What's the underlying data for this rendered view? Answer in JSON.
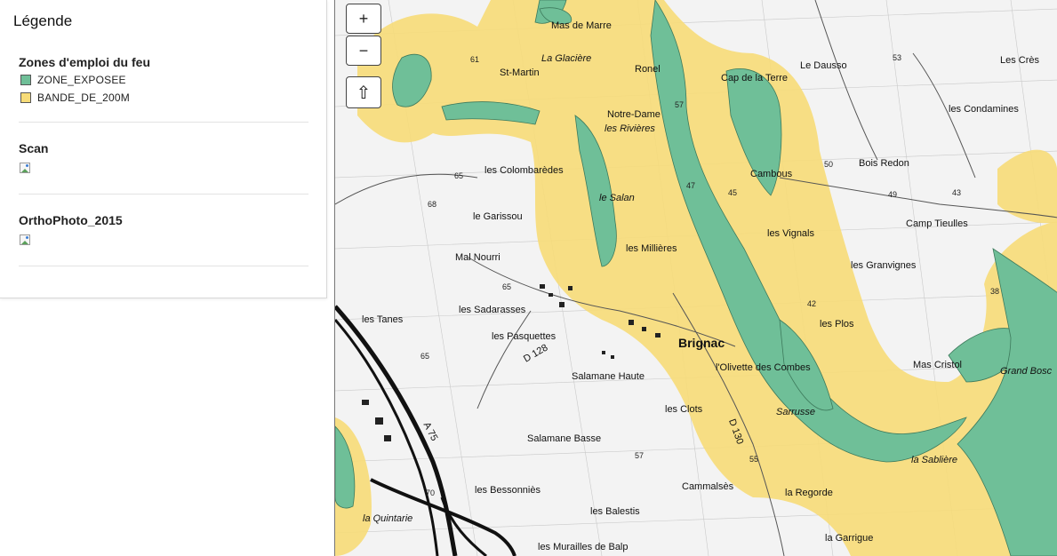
{
  "legend": {
    "title": "Légende",
    "sections": [
      {
        "title": "Zones d'emploi du feu",
        "items": [
          {
            "label": "ZONE_EXPOSEE",
            "color": "#6fbf98"
          },
          {
            "label": "BANDE_DE_200M",
            "color": "#f7dc78"
          }
        ]
      },
      {
        "title": "Scan",
        "image_icon": "broken-image-icon"
      },
      {
        "title": "OrthoPhoto_2015",
        "image_icon": "broken-image-icon"
      }
    ]
  },
  "map": {
    "controls": {
      "zoom_in": "+",
      "zoom_out": "−",
      "home": "⇧"
    },
    "colors": {
      "zone_exposee": "#6fbf98",
      "bande_200m": "#f7dc78"
    },
    "place_labels": [
      "Mas de Marre",
      "Ronel",
      "Le Dausso",
      "Les Crès",
      "La Glacière",
      "St-Martin",
      "Notre-Dame",
      "les Rivières",
      "Cap de la Terre",
      "les Condamines",
      "Cambous",
      "Bois Redon",
      "les Colombarèdes",
      "le Salan",
      "le Garissou",
      "Camp Tieulles",
      "les Vignals",
      "les Granvignes",
      "Mal Nourri",
      "les Millières",
      "les Sadarasses",
      "Brignac",
      "les Plos",
      "les Tanes",
      "les Pasquettes",
      "Mas Cristol",
      "Grand Bosc",
      "l'Olivette des Combes",
      "Salamane Haute",
      "les Clots",
      "Sarrusse",
      "Salamane Basse",
      "la Sablière",
      "les Bessonniès",
      "Cammalsès",
      "la Regorde",
      "les Balestis",
      "la Quintarie",
      "les Murailles de Balp",
      "la Garrigue",
      "A 75",
      "D 128",
      "D 130"
    ],
    "elevations": [
      "61",
      "53",
      "57",
      "65",
      "68",
      "50",
      "49",
      "43",
      "45",
      "47",
      "65",
      "42",
      "38",
      "65",
      "57",
      "55",
      "70"
    ]
  }
}
